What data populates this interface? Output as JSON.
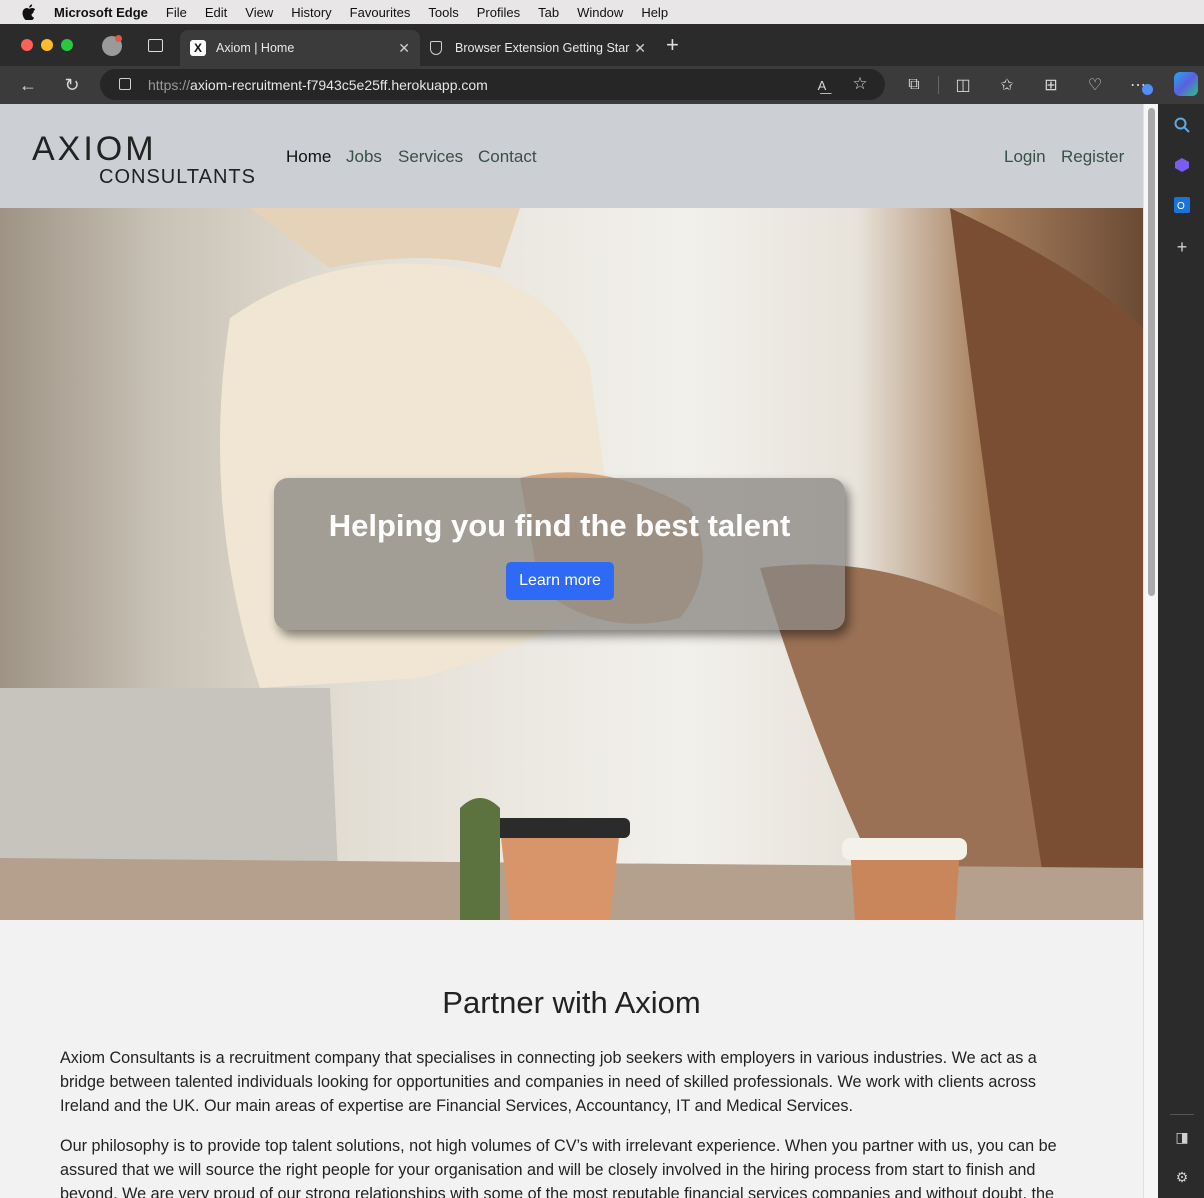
{
  "menubar": {
    "app": "Microsoft Edge",
    "items": [
      "File",
      "Edit",
      "View",
      "History",
      "Favourites",
      "Tools",
      "Profiles",
      "Tab",
      "Window",
      "Help"
    ]
  },
  "tabs": [
    {
      "title": "Axiom | Home",
      "favicon": "X"
    },
    {
      "title": "Browser Extension Getting Star",
      "favicon": "shield"
    }
  ],
  "address": {
    "prefix": "https://",
    "host": "axiom-recruitment-f7943c5e25ff.herokuapp.com"
  },
  "site": {
    "logo_line1": "AXIOM",
    "logo_line2": "CONSULTANTS",
    "nav": [
      "Home",
      "Jobs",
      "Services",
      "Contact"
    ],
    "auth": [
      "Login",
      "Register"
    ],
    "hero_title": "Helping you find the best talent",
    "hero_button": "Learn more",
    "section_title": "Partner with Axiom",
    "paragraph1": "Axiom Consultants is a recruitment company that specialises in connecting job seekers with employers in various industries. We act as a bridge between talented individuals looking for opportunities and companies in need of skilled professionals. We work with clients across Ireland and the UK. Our main areas of expertise are Financial Services, Accountancy, IT and Medical Services.",
    "paragraph2": "Our philosophy is to provide top talent solutions, not high volumes of CV’s with irrelevant experience. When you partner with us, you can be assured that we will source the right people for your organisation and will be closely involved in the hiring process from start to finish and beyond. We are very proud of our strong relationships with some of the most reputable financial services companies and without doubt, the"
  },
  "colors": {
    "accent_button": "#2e6af6",
    "navbar_bg": "#ccd0d5",
    "nav_link": "#3a4f45"
  }
}
